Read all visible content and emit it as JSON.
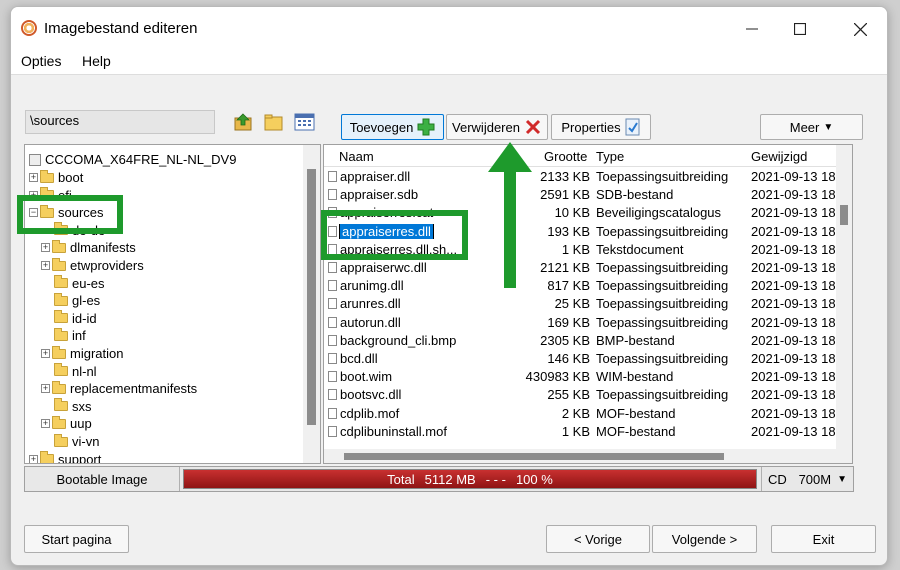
{
  "window": {
    "title": "Imagebestand editeren"
  },
  "menu": [
    "Opties",
    "Help"
  ],
  "path": "\\sources",
  "toolbar": {
    "add_label": "Toevoegen",
    "remove_label": "Verwijderen",
    "properties_label": "Properties",
    "more_label": "Meer"
  },
  "tree": {
    "root": "CCCOMA_X64FRE_NL-NL_DV9",
    "items": [
      {
        "label": "boot",
        "expandable": true,
        "level": 1
      },
      {
        "label": "efi",
        "expandable": true,
        "level": 1
      },
      {
        "label": "sources",
        "expandable": true,
        "expanded": true,
        "level": 1
      },
      {
        "label": "de-de",
        "expandable": false,
        "level": 2
      },
      {
        "label": "dlmanifests",
        "expandable": true,
        "level": 2
      },
      {
        "label": "etwproviders",
        "expandable": true,
        "level": 2
      },
      {
        "label": "eu-es",
        "expandable": false,
        "level": 2
      },
      {
        "label": "gl-es",
        "expandable": false,
        "level": 2
      },
      {
        "label": "id-id",
        "expandable": false,
        "level": 2
      },
      {
        "label": "inf",
        "expandable": false,
        "level": 2
      },
      {
        "label": "migration",
        "expandable": true,
        "level": 2
      },
      {
        "label": "nl-nl",
        "expandable": false,
        "level": 2
      },
      {
        "label": "replacementmanifests",
        "expandable": true,
        "level": 2
      },
      {
        "label": "sxs",
        "expandable": false,
        "level": 2
      },
      {
        "label": "uup",
        "expandable": true,
        "level": 2
      },
      {
        "label": "vi-vn",
        "expandable": false,
        "level": 2
      },
      {
        "label": "support",
        "expandable": true,
        "level": 1
      }
    ]
  },
  "list": {
    "columns": [
      "Naam",
      "Grootte",
      "Type",
      "Gewijzigd"
    ],
    "rows": [
      {
        "name": "appraiser.dll",
        "size": "2133 KB",
        "type": "Toepassingsuitbreiding",
        "date": "2021-09-13 18.."
      },
      {
        "name": "appraiser.sdb",
        "size": "2591 KB",
        "type": "SDB-bestand",
        "date": "2021-09-13 18.."
      },
      {
        "name": "appraiserres.cat",
        "size": "10 KB",
        "type": "Beveiligingscatalogus",
        "date": "2021-09-13 18.."
      },
      {
        "name": "appraiserres.dll",
        "size": "193 KB",
        "type": "Toepassingsuitbreiding",
        "date": "2021-09-13 18.."
      },
      {
        "name": "appraiserres.dll.sh...",
        "size": "1 KB",
        "type": "Tekstdocument",
        "date": "2021-09-13 18.."
      },
      {
        "name": "appraiserwc.dll",
        "size": "2121 KB",
        "type": "Toepassingsuitbreiding",
        "date": "2021-09-13 18.."
      },
      {
        "name": "arunimg.dll",
        "size": "817 KB",
        "type": "Toepassingsuitbreiding",
        "date": "2021-09-13 18.."
      },
      {
        "name": "arunres.dll",
        "size": "25 KB",
        "type": "Toepassingsuitbreiding",
        "date": "2021-09-13 18.."
      },
      {
        "name": "autorun.dll",
        "size": "169 KB",
        "type": "Toepassingsuitbreiding",
        "date": "2021-09-13 18.."
      },
      {
        "name": "background_cli.bmp",
        "size": "2305 KB",
        "type": "BMP-bestand",
        "date": "2021-09-13 18.."
      },
      {
        "name": "bcd.dll",
        "size": "146 KB",
        "type": "Toepassingsuitbreiding",
        "date": "2021-09-13 18.."
      },
      {
        "name": "boot.wim",
        "size": "430983 KB",
        "type": "WIM-bestand",
        "date": "2021-09-13 18.."
      },
      {
        "name": "bootsvc.dll",
        "size": "255 KB",
        "type": "Toepassingsuitbreiding",
        "date": "2021-09-13 18.."
      },
      {
        "name": "cdplib.mof",
        "size": "2 KB",
        "type": "MOF-bestand",
        "date": "2021-09-13 18.."
      },
      {
        "name": "cdplibuninstall.mof",
        "size": "1 KB",
        "type": "MOF-bestand",
        "date": "2021-09-13 18.."
      }
    ],
    "editing_name": "appraiserres.dll"
  },
  "status": {
    "label": "Bootable Image",
    "total_label": "Total",
    "total_size": "5112 MB",
    "separator": "- - -",
    "percent_text": "100 %",
    "percent": 100,
    "media": "CD",
    "capacity": "700M"
  },
  "nav": {
    "start": "Start pagina",
    "prev": "< Vorige",
    "next": "Volgende >",
    "exit": "Exit"
  },
  "colors": {
    "highlight": "#1e9a2c",
    "progress": "#b31b1b",
    "selection": "#0078d7"
  }
}
